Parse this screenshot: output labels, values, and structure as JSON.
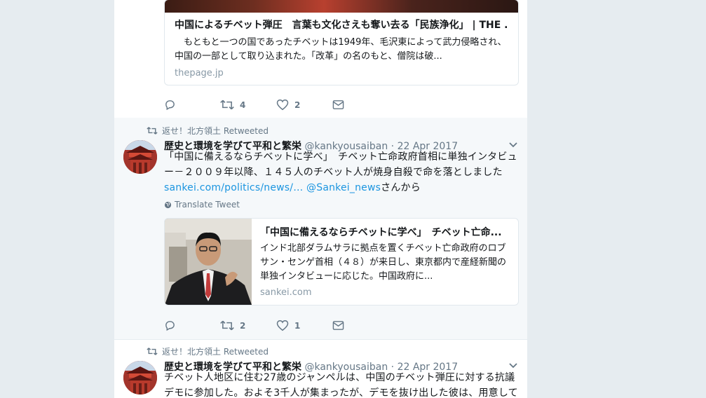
{
  "top_card": {
    "title": "中国によるチベット弾圧　言葉も文化さえも奪い去る「民族浄化」 | THE ...",
    "desc": "　もともと一つの国であったチベットは1949年、毛沢東によって武力侵略され、中国の一部として取り込まれた。「改革」の名のもと、僧院は破...",
    "domain": "thepage.jp"
  },
  "tweet0_actions": {
    "retweets": "4",
    "likes": "2"
  },
  "tweet1": {
    "context": "返せ！北方領土 Retweeted",
    "name": "歴史と環境を学びて平和と繁栄",
    "handle": "@kankyousaiban",
    "dot": "·",
    "time": "22 Apr 2017",
    "text_main": "「中国に備えるならチベットに学べ」　チベット亡命政府首相に単独インタビュー－２００９年以降、１４５人のチベット人が焼身自殺で命を落としました",
    "link1": "sankei.com/politics/news/…",
    "link2": "@Sankei_news",
    "text_tail": "さんから",
    "translate": "Translate Tweet",
    "card": {
      "title": "「中国に備えるならチベットに学べ」　チベット亡命...",
      "desc": "インド北部ダラムサラに拠点を置くチベット亡命政府のロブサン・センゲ首相（４８）が来日し、東京都内で産経新聞の単独インタビューに応じた。中国政府に...",
      "domain": "sankei.com"
    },
    "actions": {
      "retweets": "2",
      "likes": "1"
    }
  },
  "tweet2": {
    "context": "返せ！北方領土 Retweeted",
    "name": "歴史と環境を学びて平和と繁栄",
    "handle": "@kankyousaiban",
    "dot": "·",
    "time": "22 Apr 2017",
    "text": "チベット人地区に住む27歳のジャンペルは、中国のチベット弾圧に対する抗議デモに参加した。およそ3千人が集まったが、デモを抜け出した彼は、用意してき"
  },
  "icons": {
    "retweet": "retweet-icon",
    "reply": "reply-icon",
    "like": "heart-icon",
    "dm": "envelope-icon",
    "caret": "chevron-down-icon",
    "globe": "globe-icon"
  },
  "colors": {
    "link": "#1b95e0",
    "muted": "#657786",
    "bg": "#e6ecf0"
  }
}
